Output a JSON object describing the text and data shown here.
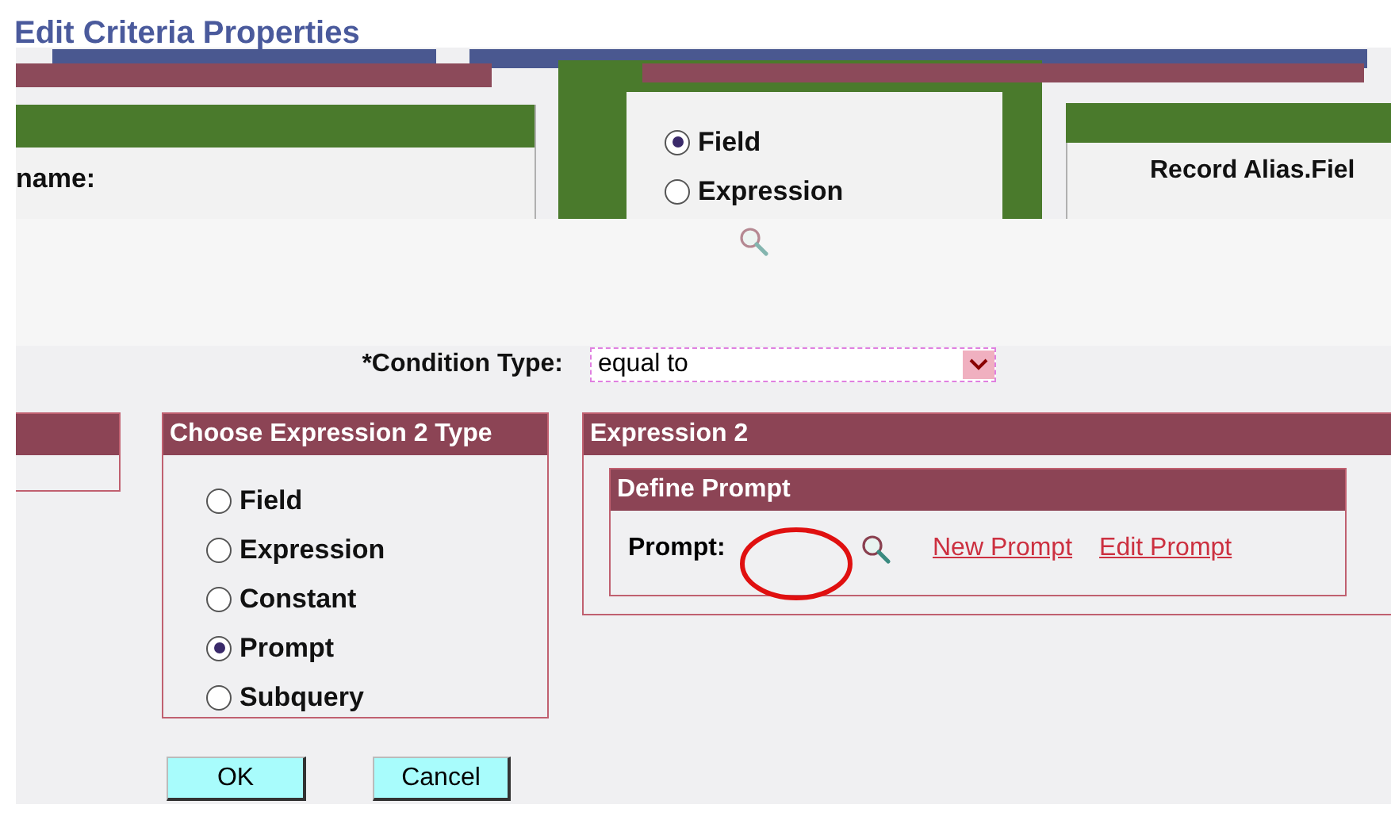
{
  "title": "Edit Criteria Properties",
  "upper_panel": {
    "name_label": "name:",
    "expression_1_type": [
      {
        "label": "Field",
        "selected": true
      },
      {
        "label": "Expression",
        "selected": false
      }
    ],
    "record_field_heading": "Record Alias.Fiel"
  },
  "condition_type": {
    "label": "*Condition Type:",
    "value": "equal to"
  },
  "expression_2_type": {
    "title": "Choose Expression 2 Type",
    "options": [
      {
        "label": "Field",
        "selected": false
      },
      {
        "label": "Expression",
        "selected": false
      },
      {
        "label": "Constant",
        "selected": false
      },
      {
        "label": "Prompt",
        "selected": true
      },
      {
        "label": "Subquery",
        "selected": false
      }
    ]
  },
  "expression_2": {
    "title": "Expression 2",
    "define_prompt": {
      "title": "Define Prompt",
      "label": "Prompt:",
      "links": [
        "New Prompt",
        "Edit Prompt"
      ]
    }
  },
  "buttons": [
    "OK",
    "Cancel"
  ]
}
